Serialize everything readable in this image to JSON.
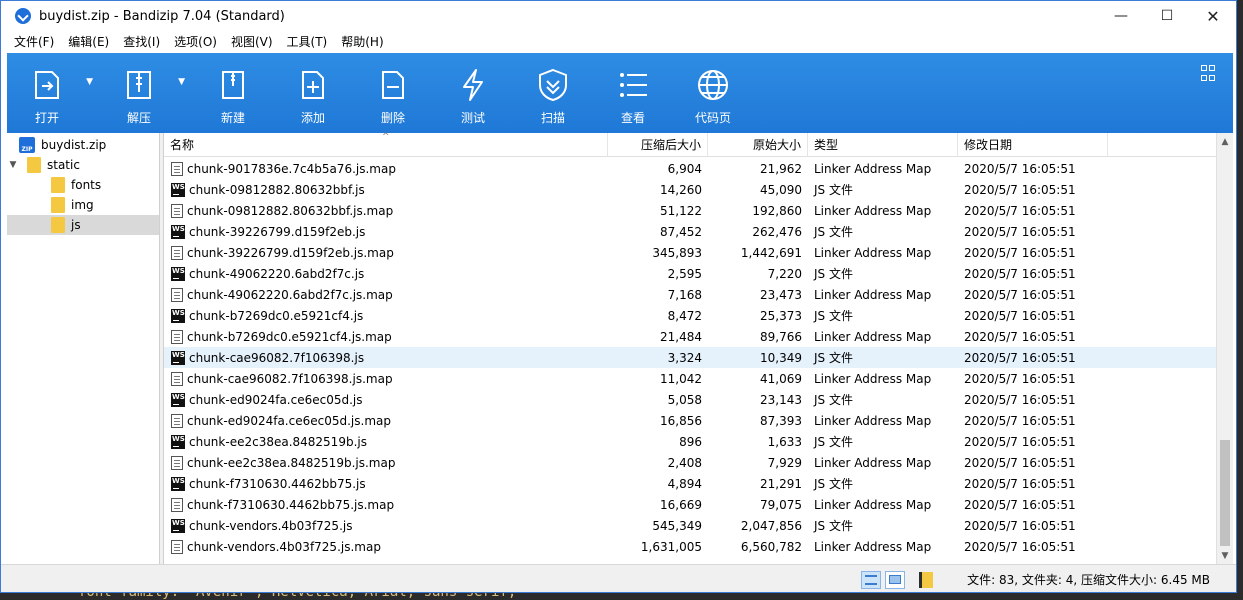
{
  "window": {
    "title": "buydist.zip - Bandizip 7.04 (Standard)",
    "controls": {
      "minimize": "—",
      "maximize": "☐",
      "close": "✕"
    }
  },
  "menubar": [
    "文件(F)",
    "编辑(E)",
    "查找(I)",
    "选项(O)",
    "视图(V)",
    "工具(T)",
    "帮助(H)"
  ],
  "toolbar": [
    {
      "label": "打开",
      "icon": "open-icon",
      "has_dropdown": true
    },
    {
      "label": "解压",
      "icon": "extract-icon",
      "has_dropdown": true
    },
    {
      "label": "新建",
      "icon": "new-archive-icon",
      "has_dropdown": false
    },
    {
      "label": "添加",
      "icon": "add-icon",
      "has_dropdown": false
    },
    {
      "label": "删除",
      "icon": "delete-icon",
      "has_dropdown": false
    },
    {
      "label": "测试",
      "icon": "test-icon",
      "has_dropdown": false
    },
    {
      "label": "扫描",
      "icon": "scan-icon",
      "has_dropdown": false
    },
    {
      "label": "查看",
      "icon": "view-icon",
      "has_dropdown": false
    },
    {
      "label": "代码页",
      "icon": "codepage-icon",
      "has_dropdown": false
    }
  ],
  "tree": [
    {
      "label": "buydist.zip",
      "level": 0,
      "type": "zip",
      "expanded": true
    },
    {
      "label": "static",
      "level": 1,
      "type": "folder",
      "expanded": true
    },
    {
      "label": "fonts",
      "level": 2,
      "type": "folder"
    },
    {
      "label": "img",
      "level": 2,
      "type": "folder"
    },
    {
      "label": "js",
      "level": 2,
      "type": "folder",
      "selected": true
    }
  ],
  "columns": {
    "name": "名称",
    "compressed": "压缩后大小",
    "original": "原始大小",
    "type": "类型",
    "modified": "修改日期"
  },
  "files": [
    {
      "name": "chunk-9017836e.7c4b5a76.js.map",
      "kind": "map",
      "compressed": "6,904",
      "original": "21,962",
      "type": "Linker Address Map",
      "modified": "2020/5/7 16:05:51"
    },
    {
      "name": "chunk-09812882.80632bbf.js",
      "kind": "js",
      "compressed": "14,260",
      "original": "45,090",
      "type": "JS 文件",
      "modified": "2020/5/7 16:05:51"
    },
    {
      "name": "chunk-09812882.80632bbf.js.map",
      "kind": "map",
      "compressed": "51,122",
      "original": "192,860",
      "type": "Linker Address Map",
      "modified": "2020/5/7 16:05:51"
    },
    {
      "name": "chunk-39226799.d159f2eb.js",
      "kind": "js",
      "compressed": "87,452",
      "original": "262,476",
      "type": "JS 文件",
      "modified": "2020/5/7 16:05:51"
    },
    {
      "name": "chunk-39226799.d159f2eb.js.map",
      "kind": "map",
      "compressed": "345,893",
      "original": "1,442,691",
      "type": "Linker Address Map",
      "modified": "2020/5/7 16:05:51"
    },
    {
      "name": "chunk-49062220.6abd2f7c.js",
      "kind": "js",
      "compressed": "2,595",
      "original": "7,220",
      "type": "JS 文件",
      "modified": "2020/5/7 16:05:51"
    },
    {
      "name": "chunk-49062220.6abd2f7c.js.map",
      "kind": "map",
      "compressed": "7,168",
      "original": "23,473",
      "type": "Linker Address Map",
      "modified": "2020/5/7 16:05:51"
    },
    {
      "name": "chunk-b7269dc0.e5921cf4.js",
      "kind": "js",
      "compressed": "8,472",
      "original": "25,373",
      "type": "JS 文件",
      "modified": "2020/5/7 16:05:51"
    },
    {
      "name": "chunk-b7269dc0.e5921cf4.js.map",
      "kind": "map",
      "compressed": "21,484",
      "original": "89,766",
      "type": "Linker Address Map",
      "modified": "2020/5/7 16:05:51"
    },
    {
      "name": "chunk-cae96082.7f106398.js",
      "kind": "js",
      "compressed": "3,324",
      "original": "10,349",
      "type": "JS 文件",
      "modified": "2020/5/7 16:05:51",
      "highlighted": true
    },
    {
      "name": "chunk-cae96082.7f106398.js.map",
      "kind": "map",
      "compressed": "11,042",
      "original": "41,069",
      "type": "Linker Address Map",
      "modified": "2020/5/7 16:05:51"
    },
    {
      "name": "chunk-ed9024fa.ce6ec05d.js",
      "kind": "js",
      "compressed": "5,058",
      "original": "23,143",
      "type": "JS 文件",
      "modified": "2020/5/7 16:05:51"
    },
    {
      "name": "chunk-ed9024fa.ce6ec05d.js.map",
      "kind": "map",
      "compressed": "16,856",
      "original": "87,393",
      "type": "Linker Address Map",
      "modified": "2020/5/7 16:05:51"
    },
    {
      "name": "chunk-ee2c38ea.8482519b.js",
      "kind": "js",
      "compressed": "896",
      "original": "1,633",
      "type": "JS 文件",
      "modified": "2020/5/7 16:05:51"
    },
    {
      "name": "chunk-ee2c38ea.8482519b.js.map",
      "kind": "map",
      "compressed": "2,408",
      "original": "7,929",
      "type": "Linker Address Map",
      "modified": "2020/5/7 16:05:51"
    },
    {
      "name": "chunk-f7310630.4462bb75.js",
      "kind": "js",
      "compressed": "4,894",
      "original": "21,291",
      "type": "JS 文件",
      "modified": "2020/5/7 16:05:51"
    },
    {
      "name": "chunk-f7310630.4462bb75.js.map",
      "kind": "map",
      "compressed": "16,669",
      "original": "79,075",
      "type": "Linker Address Map",
      "modified": "2020/5/7 16:05:51"
    },
    {
      "name": "chunk-vendors.4b03f725.js",
      "kind": "js",
      "compressed": "545,349",
      "original": "2,047,856",
      "type": "JS 文件",
      "modified": "2020/5/7 16:05:51"
    },
    {
      "name": "chunk-vendors.4b03f725.js.map",
      "kind": "map",
      "compressed": "1,631,005",
      "original": "6,560,782",
      "type": "Linker Address Map",
      "modified": "2020/5/7 16:05:51"
    }
  ],
  "statusbar": {
    "text": "文件: 83, 文件夹: 4, 压缩文件大小: 6.45 MB"
  },
  "background": {
    "code_fragment": "font-family: 'Avenir', Helvetica, Arial, sans-serif;"
  },
  "colors": {
    "toolbar": "#2f8de4",
    "highlight_row": "#e5f1fb",
    "selected_tree": "#d9d9d9"
  }
}
